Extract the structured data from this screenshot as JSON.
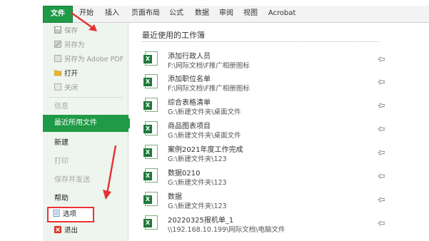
{
  "ribbon": {
    "tabs": [
      "文件",
      "开始",
      "插入",
      "页面布局",
      "公式",
      "数据",
      "审阅",
      "视图",
      "Acrobat"
    ]
  },
  "sidebar": {
    "save": "保存",
    "save_as": "另存为",
    "save_as_pdf": "另存为 Adobe PDF",
    "open": "打开",
    "close": "关闭",
    "info": "信息",
    "recent": "最近所用文件",
    "new": "新建",
    "print": "打印",
    "save_send": "保存并发送",
    "help": "帮助",
    "options": "选项",
    "exit": "退出"
  },
  "recent": {
    "title": "最近使用的工作簿",
    "files": [
      {
        "name": "添加行政人员",
        "path": "F:\\网际文档\\F推广相册图标"
      },
      {
        "name": "添加职位名单",
        "path": "F:\\网际文档\\F推广相册图标"
      },
      {
        "name": "综合表格清单",
        "path": "G:\\新建文件夹\\桌面文件"
      },
      {
        "name": "商品图表项目",
        "path": "G:\\新建文件夹\\桌面文件"
      },
      {
        "name": "案例2021年度工作完成",
        "path": "G:\\新建文件夹\\123"
      },
      {
        "name": "数据0210",
        "path": "G:\\新建文件夹\\123"
      },
      {
        "name": "数据",
        "path": "G:\\新建文件夹\\123"
      },
      {
        "name": "20220325报机单_1",
        "path": "\\\\192.168.10.199\\网际文档\\电脑文件"
      }
    ]
  },
  "colors": {
    "accent": "#1f9a46",
    "annotation": "#e33333"
  }
}
